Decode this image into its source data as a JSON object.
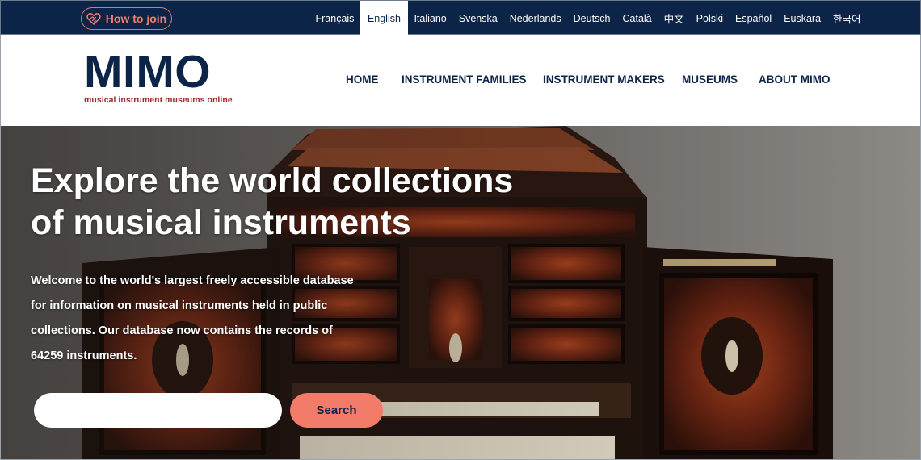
{
  "topbar": {
    "join_label": "How to join",
    "languages": [
      "Français",
      "English",
      "Italiano",
      "Svenska",
      "Nederlands",
      "Deutsch",
      "Català",
      "中文",
      "Polski",
      "Español",
      "Euskara",
      "한국어"
    ],
    "active_language": "English"
  },
  "header": {
    "logo_text": "MIMO",
    "logo_tagline": "musical instrument museums online",
    "nav": [
      "HOME",
      "INSTRUMENT FAMILIES",
      "INSTRUMENT MAKERS",
      "MUSEUMS",
      "ABOUT MIMO"
    ]
  },
  "hero": {
    "title_line1": "Explore the world collections",
    "title_line2": "of musical instruments",
    "intro_line1": "Welcome to the world's largest freely accessible database",
    "intro_line2": "for information on musical instruments held in public",
    "intro_line3": "collections. Our database now contains the records of",
    "intro_line4": "64259 instruments.",
    "search_placeholder": "",
    "search_value": "",
    "search_button": "Search"
  },
  "colors": {
    "navy": "#0c2447",
    "accent": "#f37b6a",
    "logo_tagline": "#9e2a2b"
  },
  "icons": {
    "join": "handshake-heart-icon"
  }
}
